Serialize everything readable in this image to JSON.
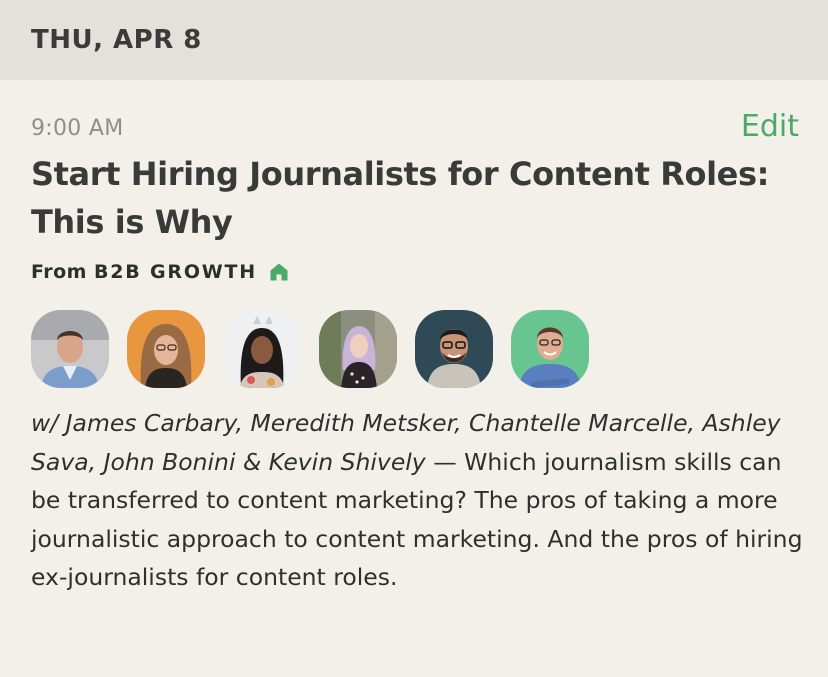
{
  "date_header": {
    "label": "THU, APR 8"
  },
  "event": {
    "time": "9:00 AM",
    "edit_label": "Edit",
    "title": "Start Hiring Journalists for Content Roles: This is Why",
    "from_prefix": "From",
    "club_name": "B2B GROWTH",
    "club_icon": "home-icon",
    "speakers": [
      {
        "name": "James Carbary",
        "bg": "#c9c9cb"
      },
      {
        "name": "Meredith Metsker",
        "bg": "#e8973f"
      },
      {
        "name": "Chantelle Marcelle",
        "bg": "#eef0f1"
      },
      {
        "name": "Ashley Sava",
        "bg": "#8b8f7f"
      },
      {
        "name": "John Bonini",
        "bg": "#2f4a56"
      },
      {
        "name": "Kevin Shively",
        "bg": "#69c590"
      }
    ],
    "description_names": "w/ James Carbary, Meredith Metsker, Chantelle Marcelle, Ashley Sava, John Bonini & Kevin Shively",
    "description_text": " — Which journalism skills can be transferred to content marketing? The pros of taking a more journalistic approach to content marketing. And the pros of hiring ex-journalists for content roles."
  },
  "colors": {
    "header_bg": "#e2e1da",
    "page_bg": "#f2f0e9",
    "accent_green": "#4caa68",
    "time_gray": "#8e8e8a"
  }
}
